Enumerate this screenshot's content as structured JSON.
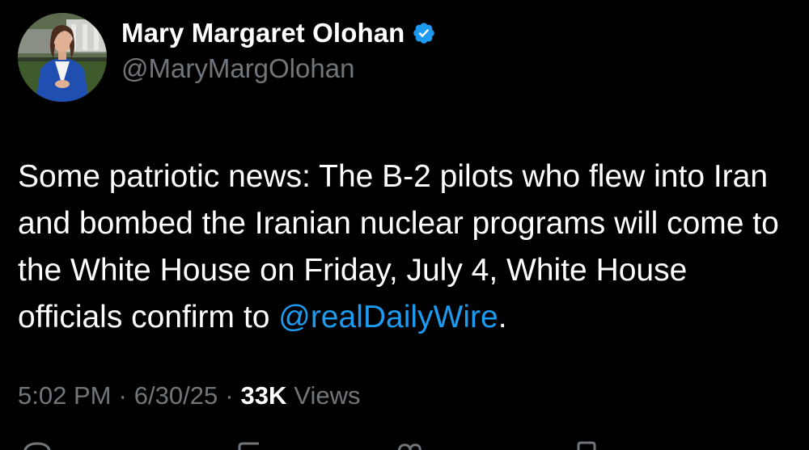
{
  "author": {
    "display_name": "Mary Margaret Olohan",
    "handle": "@MaryMargOlohan",
    "verified_icon": "verified-badge-icon",
    "avatar_icon": "profile-photo"
  },
  "tweet": {
    "text_before": "Some patriotic news: The B-2 pilots who flew into Iran and bombed the Iranian nuclear programs will come to the White House on Friday, July 4, White House officials confirm to ",
    "mention": "@realDailyWire",
    "text_after": "."
  },
  "meta": {
    "time": "5:02 PM",
    "separator": "·",
    "date": "6/30/25",
    "views_count": "33K",
    "views_label": "Views"
  },
  "actions": [
    "reply-icon",
    "retweet-icon",
    "like-icon",
    "bookmark-icon"
  ],
  "colors": {
    "background": "#000000",
    "text": "#ffffff",
    "secondary": "#71767b",
    "accent": "#1d9bf0"
  }
}
